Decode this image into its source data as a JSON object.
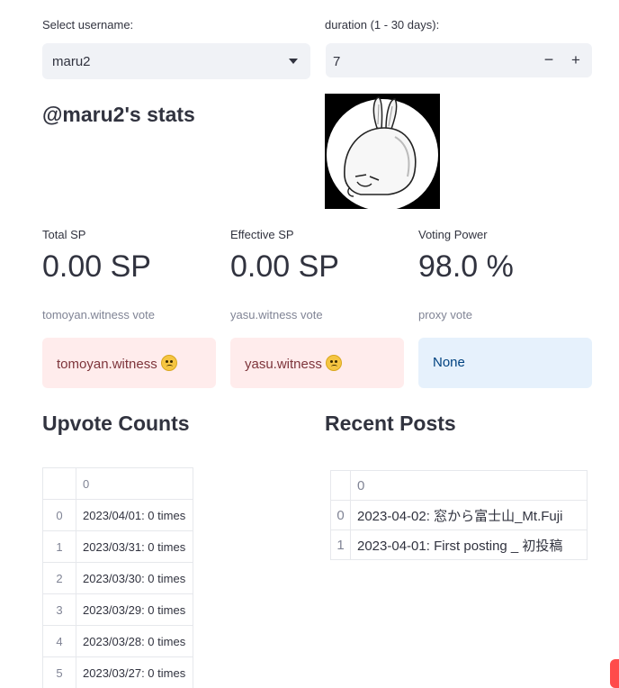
{
  "username": {
    "label": "Select username:",
    "value": "maru2"
  },
  "duration": {
    "label": "duration (1 - 30 days):",
    "value": "7",
    "minus": "−",
    "plus": "+"
  },
  "stats_title": "@maru2's stats",
  "metrics": [
    {
      "label": "Total SP",
      "value": "0.00 SP"
    },
    {
      "label": "Effective SP",
      "value": "0.00 SP"
    },
    {
      "label": "Voting Power",
      "value": "98.0 %"
    }
  ],
  "votes": [
    {
      "label": "tomoyan.witness vote",
      "text": "tomoyan.witness",
      "emoji": "worried-face-icon"
    },
    {
      "label": "yasu.witness vote",
      "text": "yasu.witness",
      "emoji": "worried-face-icon"
    },
    {
      "label": "proxy vote",
      "text": "None"
    }
  ],
  "upvote_counts": {
    "title": "Upvote Counts",
    "column": "0",
    "rows": [
      {
        "index": "0",
        "value": "2023/04/01: 0 times"
      },
      {
        "index": "1",
        "value": "2023/03/31: 0 times"
      },
      {
        "index": "2",
        "value": "2023/03/30: 0 times"
      },
      {
        "index": "3",
        "value": "2023/03/29: 0 times"
      },
      {
        "index": "4",
        "value": "2023/03/28: 0 times"
      },
      {
        "index": "5",
        "value": "2023/03/27: 0 times"
      }
    ]
  },
  "recent_posts": {
    "title": "Recent Posts",
    "column": "0",
    "rows": [
      {
        "index": "0",
        "value": "2023-04-02: 窓から富士山_Mt.Fuji"
      },
      {
        "index": "1",
        "value": "2023-04-01: First posting _ 初投稿"
      }
    ]
  },
  "colors": {
    "error_bg": "#ffecec",
    "info_bg": "#e6f1fc",
    "accent": "#ff4b4b"
  }
}
